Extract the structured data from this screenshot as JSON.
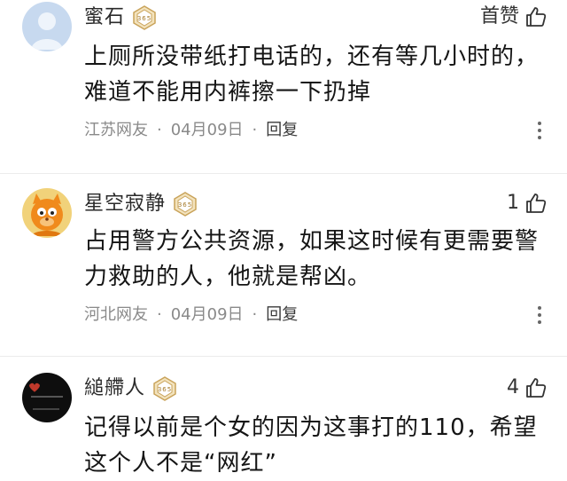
{
  "comments": [
    {
      "username": "蜜石",
      "badge": "365",
      "like_label": "首赞",
      "text": "上厕所没带纸打电话的，还有等几小时的，难道不能用内裤擦一下扔掉",
      "region": "江苏网友",
      "date": "04月09日",
      "separator": "·",
      "reply": "回复",
      "avatar_icon": "default-person-avatar"
    },
    {
      "username": "星空寂静",
      "badge": "365",
      "like_label": "1",
      "text": "占用警方公共资源，如果这时候有更需要警力救助的人，他就是帮凶。",
      "region": "河北网友",
      "date": "04月09日",
      "separator": "·",
      "reply": "回复",
      "avatar_icon": "cartoon-cat-avatar"
    },
    {
      "username": "縋艜人",
      "badge": "365",
      "like_label": "4",
      "text": "记得以前是个女的因为这事打的110，希望这个人不是“网红”",
      "avatar_icon": "dark-photo-avatar"
    }
  ],
  "colors": {
    "badge_gold": "#c9a35a",
    "meta_gray": "#8a8a8a",
    "avatar_blue": "#c7d9ef"
  }
}
